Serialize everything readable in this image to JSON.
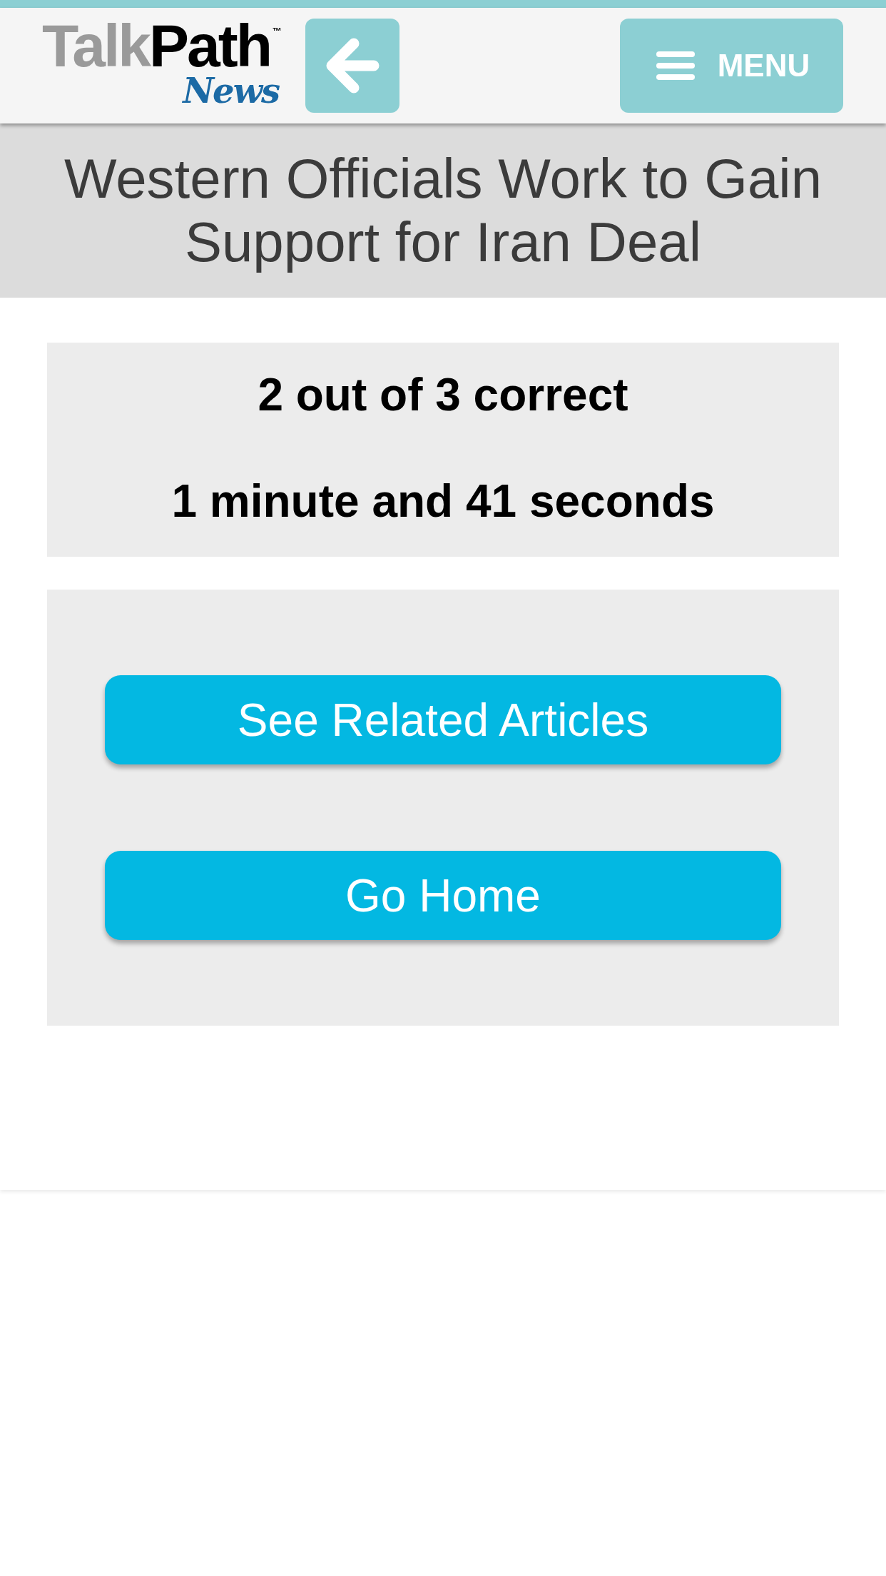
{
  "header": {
    "logo": {
      "wordmark": [
        "Talk",
        "Path"
      ],
      "trademark": "™",
      "subtitle": "News"
    },
    "menu_button": {
      "label": "MENU"
    }
  },
  "title": "Western Officials Work to Gain Support for Iran Deal",
  "result": {
    "score": "2 out of 3 correct",
    "time": "1 minute and 41 seconds"
  },
  "actions": [
    "See Related Articles",
    "Go Home"
  ]
}
